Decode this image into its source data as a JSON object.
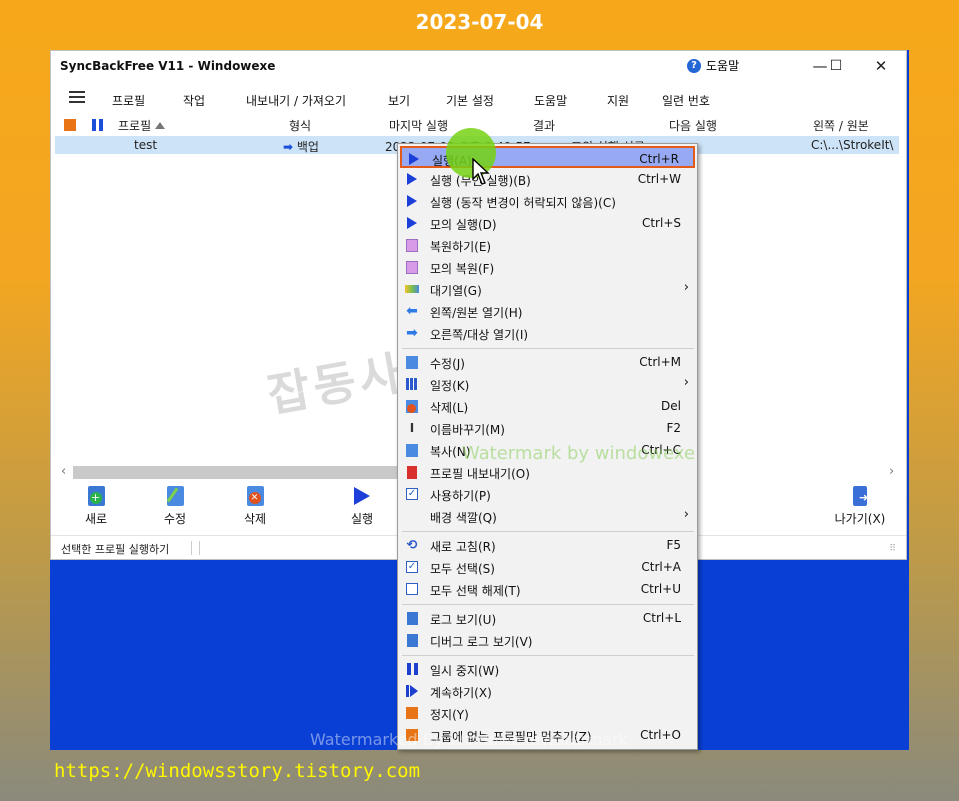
{
  "header": {
    "date": "2023-07-04"
  },
  "footer": {
    "url": "https://windowsstory.tistory.com"
  },
  "window": {
    "title": "SyncBackFree V11  - Windowexe",
    "help_label": "도움말",
    "controls": {
      "minimize": "—",
      "maximize": "☐",
      "close": "✕"
    }
  },
  "menubar": {
    "items": [
      "프로필",
      "작업",
      "내보내기 / 가져오기",
      "보기",
      "기본 설정",
      "도움말",
      "지원",
      "일련 번호"
    ]
  },
  "columns": [
    "프로필",
    "형식",
    "마지막 실행",
    "결과",
    "다음 실행",
    "왼쪽 / 원본"
  ],
  "profiles": [
    {
      "name": "test",
      "type": "백업",
      "last_run": "2023-07-03 오후 9:49:57",
      "result": "모의 실행 성공",
      "next_run": "",
      "source": "C:\\...\\StrokeIt\\"
    }
  ],
  "toolbar": {
    "new": "새로",
    "edit": "수정",
    "delete": "삭제",
    "run": "실행",
    "exit": "나가기(X)"
  },
  "status": {
    "text": "선택한 프로필 실행하기"
  },
  "context_menu": {
    "items": [
      {
        "label": "실행(A)",
        "shortcut": "Ctrl+R",
        "icon": "play-icon",
        "highlighted": true
      },
      {
        "label": "실행 (무인 실행)(B)",
        "shortcut": "Ctrl+W",
        "icon": "play-icon"
      },
      {
        "label": "실행 (동작 변경이 허락되지 않음)(C)",
        "shortcut": "",
        "icon": "play-icon"
      },
      {
        "label": "모의 실행(D)",
        "shortcut": "Ctrl+S",
        "icon": "play-icon"
      },
      {
        "label": "복원하기(E)",
        "shortcut": "",
        "icon": "restore-icon"
      },
      {
        "label": "모의 복원(F)",
        "shortcut": "",
        "icon": "restore-icon"
      },
      {
        "label": "대기열(G)",
        "shortcut": "",
        "icon": "queue-icon",
        "submenu": true
      },
      {
        "label": "왼쪽/원본 열기(H)",
        "shortcut": "",
        "icon": "arrow-left-icon"
      },
      {
        "label": "오른쪽/대상 열기(I)",
        "shortcut": "",
        "icon": "arrow-right-icon"
      },
      {
        "label": "수정(J)",
        "shortcut": "Ctrl+M",
        "icon": "edit-icon"
      },
      {
        "label": "일정(K)",
        "shortcut": "",
        "icon": "calendar-icon",
        "submenu": true
      },
      {
        "label": "삭제(L)",
        "shortcut": "Del",
        "icon": "delete-icon"
      },
      {
        "label": "이름바꾸기(M)",
        "shortcut": "F2",
        "icon": "rename-icon"
      },
      {
        "label": "복사(N)",
        "shortcut": "Ctrl+C",
        "icon": "copy-icon"
      },
      {
        "label": "프로필 내보내기(O)",
        "shortcut": "",
        "icon": "export-icon"
      },
      {
        "label": "사용하기(P)",
        "shortcut": "",
        "icon": "checkbox-icon"
      },
      {
        "label": "배경 색깔(Q)",
        "shortcut": "",
        "icon": "",
        "submenu": true
      },
      {
        "label": "새로 고침(R)",
        "shortcut": "F5",
        "icon": "refresh-icon"
      },
      {
        "label": "모두 선택(S)",
        "shortcut": "Ctrl+A",
        "icon": "checkbox-icon"
      },
      {
        "label": "모두 선택 해제(T)",
        "shortcut": "Ctrl+U",
        "icon": "empty-box-icon"
      },
      {
        "label": "로그 보기(U)",
        "shortcut": "Ctrl+L",
        "icon": "log-icon"
      },
      {
        "label": "디버그 로그 보기(V)",
        "shortcut": "",
        "icon": "log-icon"
      },
      {
        "label": "일시 중지(W)",
        "shortcut": "",
        "icon": "pause-icon"
      },
      {
        "label": "계속하기(X)",
        "shortcut": "",
        "icon": "resume-icon"
      },
      {
        "label": "정지(Y)",
        "shortcut": "",
        "icon": "stop-icon"
      },
      {
        "label": "그룹에 없는 프로필만 멈추기(Z)",
        "shortcut": "Ctrl+O",
        "icon": "stop-icon"
      }
    ]
  },
  "watermarks": {
    "big": "잡동사니 블로그",
    "green": "Watermark by windowexe",
    "bottom": "Watermarked By WindowexeWatermark"
  }
}
